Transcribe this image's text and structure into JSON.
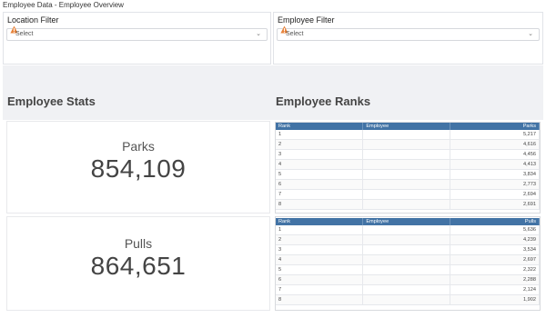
{
  "page": {
    "title": "Employee Data - Employee Overview"
  },
  "filters": {
    "location": {
      "label": "Location Filter",
      "placeholder": "Select"
    },
    "employee": {
      "label": "Employee Filter",
      "placeholder": "Select"
    }
  },
  "sections": {
    "stats_title": "Employee Stats",
    "ranks_title": "Employee Ranks"
  },
  "stats": {
    "parks": {
      "label": "Parks",
      "value": "854,109"
    },
    "pulls": {
      "label": "Pulls",
      "value": "864,651"
    }
  },
  "parks_table": {
    "headers": [
      "Rank",
      "Employee",
      "Parks"
    ],
    "rows": [
      [
        "1",
        "",
        "5,217"
      ],
      [
        "2",
        "",
        "4,616"
      ],
      [
        "3",
        "",
        "4,456"
      ],
      [
        "4",
        "",
        "4,413"
      ],
      [
        "5",
        "",
        "3,834"
      ],
      [
        "6",
        "",
        "2,773"
      ],
      [
        "7",
        "",
        "2,694"
      ],
      [
        "8",
        "",
        "2,691"
      ]
    ]
  },
  "pulls_table": {
    "headers": [
      "Rank",
      "Employee",
      "Pulls"
    ],
    "rows": [
      [
        "1",
        "",
        "5,636"
      ],
      [
        "2",
        "",
        "4,239"
      ],
      [
        "3",
        "",
        "3,534"
      ],
      [
        "4",
        "",
        "2,697"
      ],
      [
        "5",
        "",
        "2,322"
      ],
      [
        "6",
        "",
        "2,288"
      ],
      [
        "7",
        "",
        "2,124"
      ],
      [
        "8",
        "",
        "1,902"
      ]
    ]
  },
  "icons": {
    "filter_warning": "warning-icon",
    "dropdown": "chevron-down-icon"
  },
  "colors": {
    "table_header": "#4273a5",
    "band": "#f0f1f4"
  }
}
